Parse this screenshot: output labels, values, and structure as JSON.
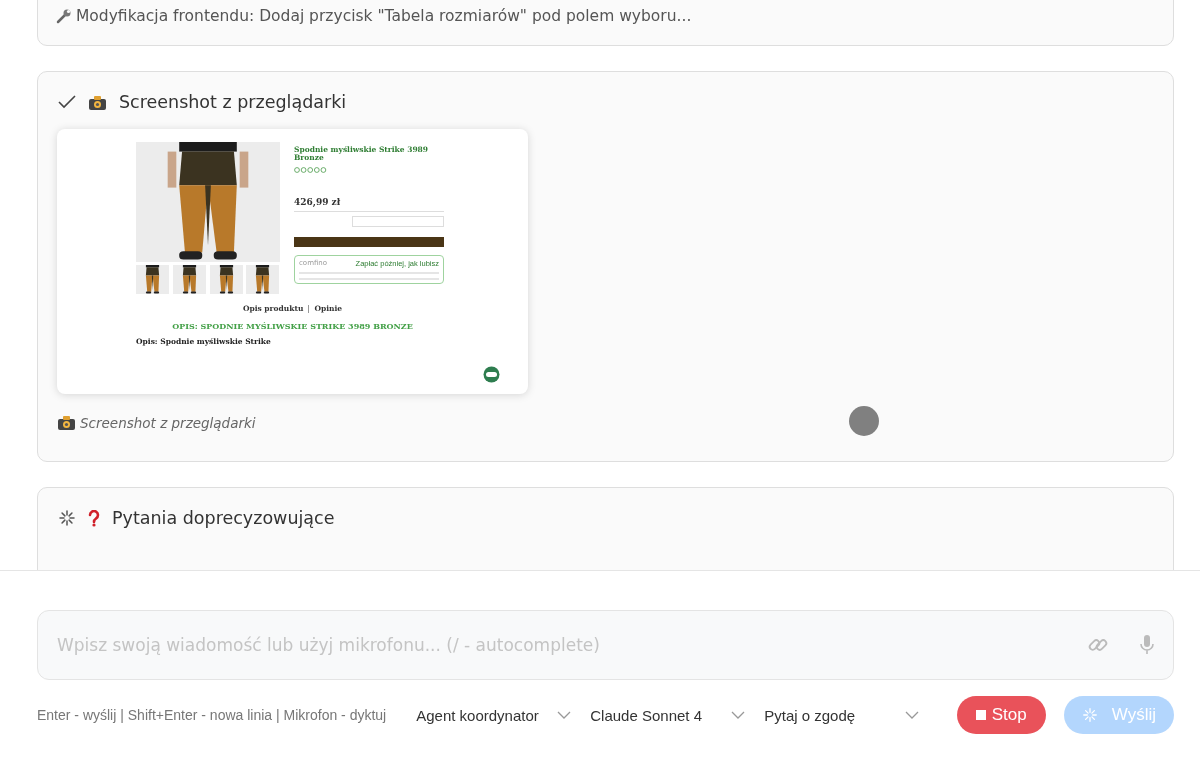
{
  "messages": [
    {
      "kind": "tool",
      "text": "Modyfikacja frontendu: Dodaj przycisk \"Tabela rozmiarów\" pod polem wyboru..."
    },
    {
      "kind": "screenshot",
      "completed": true,
      "title": "Screenshot z przeglądarki",
      "caption": "Screenshot z przeglądarki",
      "page": {
        "product_title": "Spodnie myśliwskie Strike 3989 Bronze",
        "price": "426,99 zł",
        "comfino": "comfino",
        "comfino_slogan": "Zapłać później, jak lubisz",
        "tabs": [
          "Opis produktu",
          "Opinie"
        ],
        "heading": "OPIS: SPODNIE MYŚLIWSKIE STRIKE 3989 BRONZE",
        "description": "Opis: Spodnie myśliwskie Strike"
      }
    },
    {
      "kind": "question",
      "completed": false,
      "title": "Pytania doprecyzowujące"
    }
  ],
  "composer": {
    "placeholder": "Wpisz swoją wiadomość lub użyj mikrofonu... (/ - autocomplete)",
    "hint": "Enter - wyślij | Shift+Enter - nowa linia | Mikrofon - dyktuj",
    "selects": [
      "Agent koordynator",
      "Claude Sonnet 4",
      "Pytaj o zgodę"
    ],
    "stop": "Stop",
    "send": {
      "label": "Wyślij",
      "disabled": true
    }
  }
}
